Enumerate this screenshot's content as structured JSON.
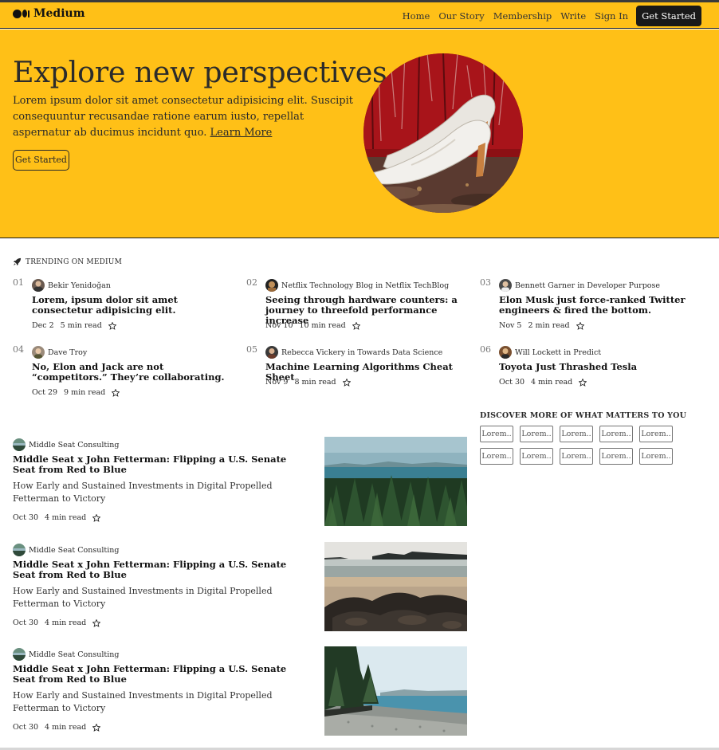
{
  "header": {
    "brand": "Medium",
    "nav": [
      "Home",
      "Our Story",
      "Membership",
      "Write",
      "Sign In"
    ],
    "cta": "Get Started"
  },
  "hero": {
    "title": "Explore new perspectives",
    "text": "Lorem ipsum dolor sit amet consectetur adipisicing elit. Suscipit consequuntur recusandae ratione earum iusto, repellat aspernatur ab ducimus incidunt quo.",
    "link": "Learn More",
    "button": "Get Started"
  },
  "trending": {
    "heading": "TRENDING ON MEDIUM",
    "items": [
      {
        "num": "01",
        "author": "Bekir Yenidoğan",
        "title": "Lorem, ipsum dolor sit amet consectetur adipisicing elit.",
        "date": "Dec 2",
        "read": "5 min read"
      },
      {
        "num": "02",
        "author": "Netflix Technology Blog in Netflix TechBlog",
        "title": "Seeing through hardware counters: a journey to threefold performance increase",
        "date": "Nov 10",
        "read": "10 min read"
      },
      {
        "num": "03",
        "author": "Bennett Garner in Developer Purpose",
        "title": "Elon Musk just force-ranked Twitter engineers & fired the bottom.",
        "date": "Nov 5",
        "read": "2 min read"
      },
      {
        "num": "04",
        "author": "Dave Troy",
        "title": "No, Elon and Jack are not “competitors.” They’re collaborating.",
        "date": "Oct 29",
        "read": "9 min read"
      },
      {
        "num": "05",
        "author": "Rebecca Vickery in Towards Data Science",
        "title": "Machine Learning Algorithms Cheat Sheet",
        "date": "Nov 9",
        "read": "8 min read"
      },
      {
        "num": "06",
        "author": "Will Lockett in Predict",
        "title": "Toyota Just Thrashed Tesla",
        "date": "Oct 30",
        "read": "4 min read"
      }
    ]
  },
  "posts": [
    {
      "author": "Middle Seat Consulting",
      "title": "Middle Seat x John Fetterman: Flipping a U.S. Senate Seat from Red to Blue",
      "subtitle": "How Early and Sustained Investments in Digital Propelled Fetterman to Victory",
      "date": "Oct 30",
      "read": "4 min read"
    },
    {
      "author": "Middle Seat Consulting",
      "title": "Middle Seat x John Fetterman: Flipping a U.S. Senate Seat from Red to Blue",
      "subtitle": "How Early and Sustained Investments in Digital Propelled Fetterman to Victory",
      "date": "Oct 30",
      "read": "4 min read"
    },
    {
      "author": "Middle Seat Consulting",
      "title": "Middle Seat x John Fetterman: Flipping a U.S. Senate Seat from Red to Blue",
      "subtitle": "How Early and Sustained Investments in Digital Propelled Fetterman to Victory",
      "date": "Oct 30",
      "read": "4 min read"
    }
  ],
  "discover": {
    "heading": "DISCOVER MORE OF WHAT MATTERS TO YOU",
    "tags": [
      "Lorem..",
      "Lorem..",
      "Lorem..",
      "Lorem..",
      "Lorem..",
      "Lorem..",
      "Lorem..",
      "Lorem..",
      "Lorem..",
      "Lorem.."
    ]
  },
  "colors": {
    "brand_yellow": "#ffc017",
    "dark": "#191919"
  },
  "icons": {
    "trending": "rocket-icon",
    "save": "star-icon",
    "logo": "medium-logo-icon"
  }
}
